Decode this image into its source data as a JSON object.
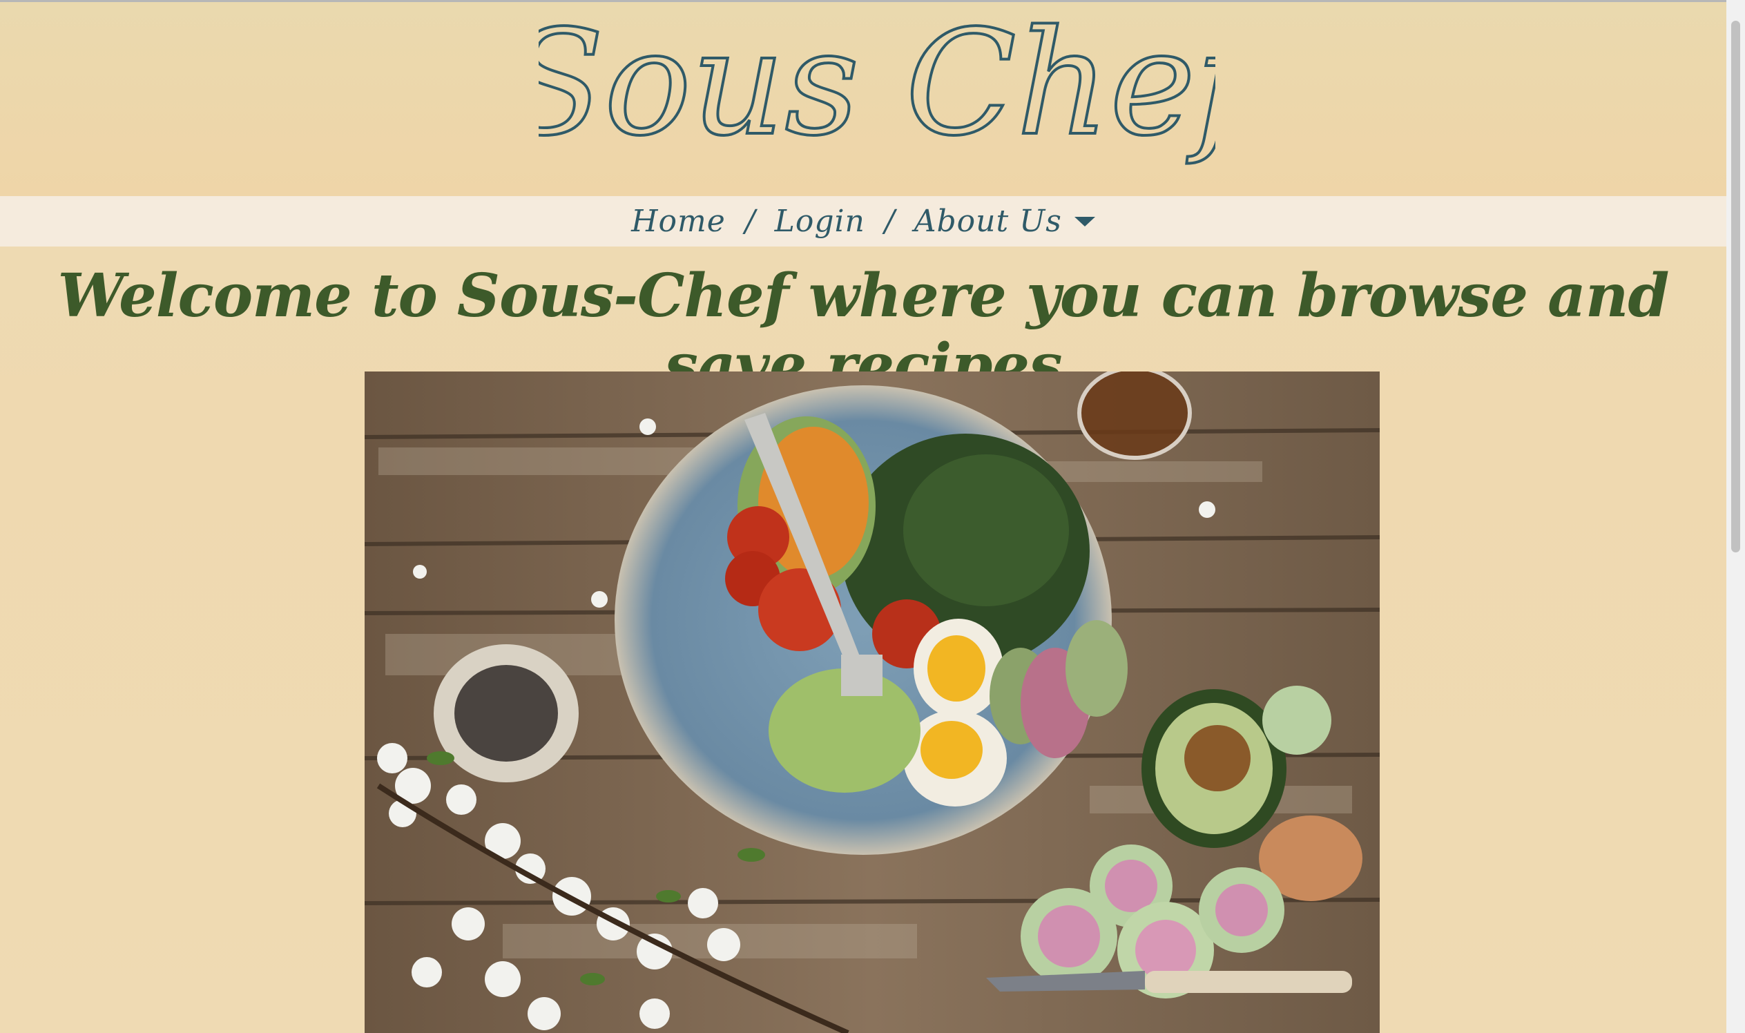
{
  "header": {
    "logo_text": "Sous Chef"
  },
  "nav": {
    "items": [
      {
        "label": "Home"
      },
      {
        "label": "Login"
      },
      {
        "label": "About Us"
      }
    ],
    "separator": "/"
  },
  "main": {
    "heading": "Welcome to Sous-Chef where you can browse and save recipes"
  },
  "colors": {
    "page_bg": "#ecdbb6",
    "nav_bg": "#f5ebdd",
    "nav_text": "#2f5a68",
    "heading": "#3d5a2a",
    "logo_stroke": "#2f5a68"
  },
  "hero_image": {
    "icon": "food-bowl-photo"
  }
}
